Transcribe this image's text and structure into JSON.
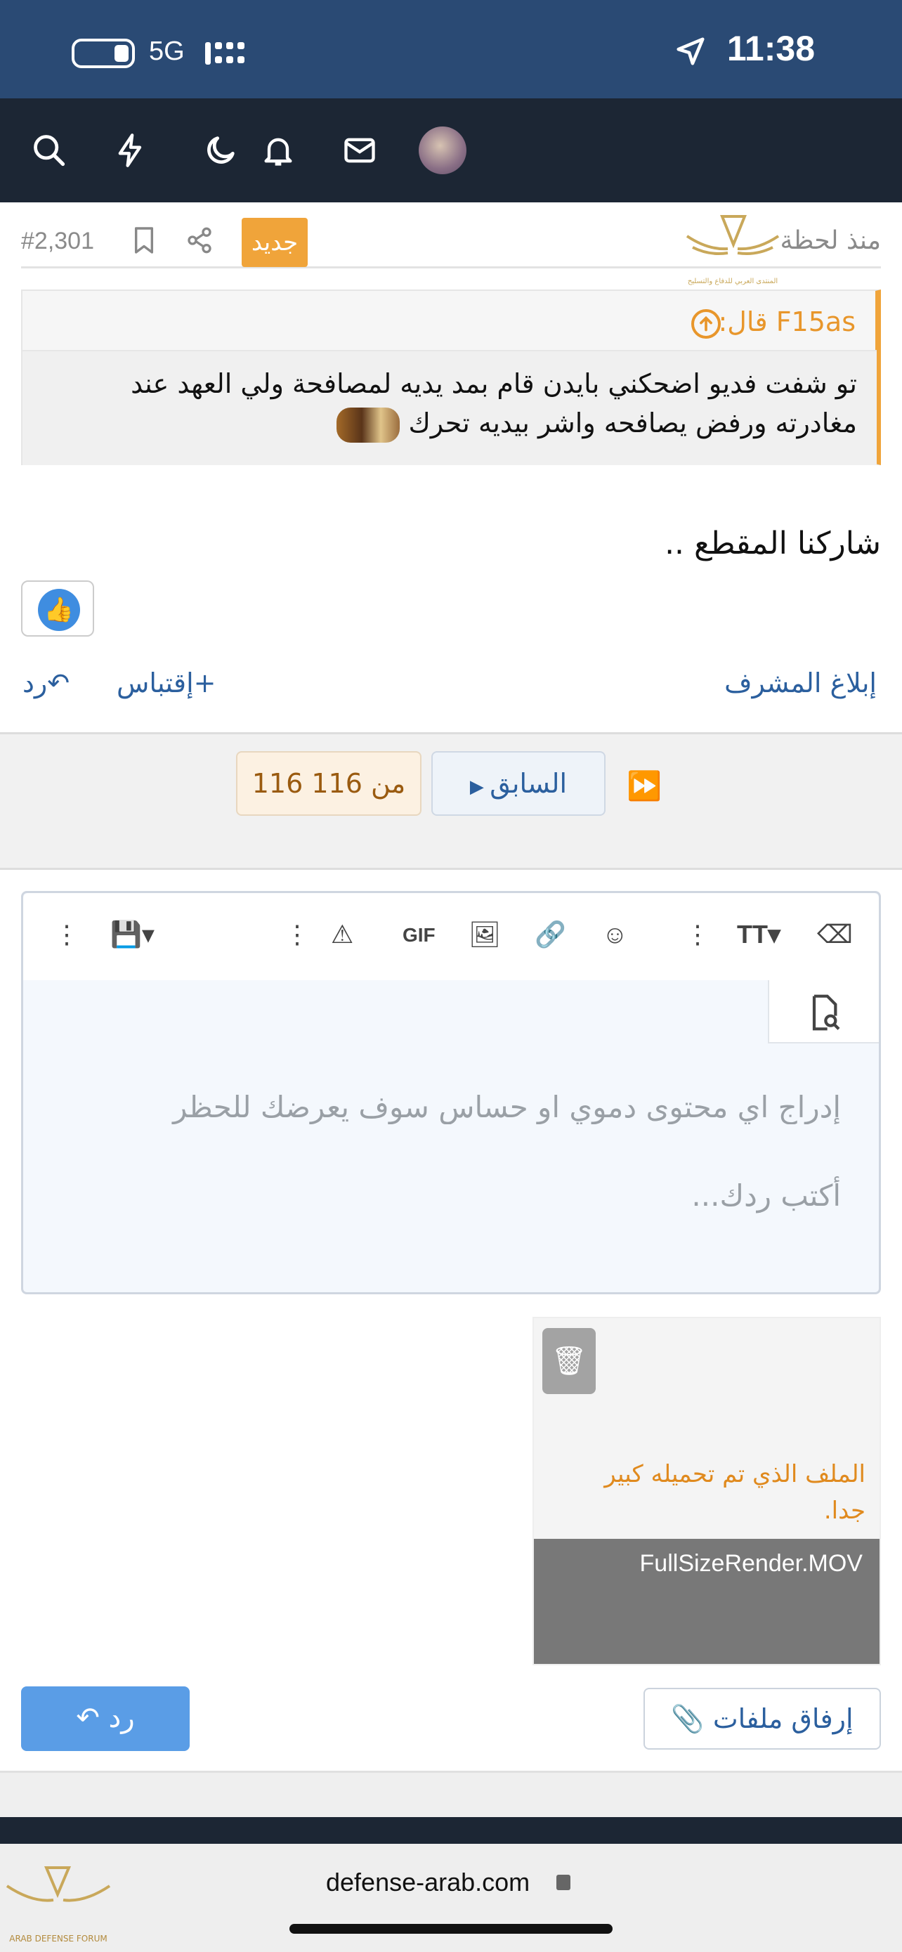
{
  "status": {
    "time": "11:38",
    "network": "5G"
  },
  "nav": {
    "logo_caption": "المنتدى العربي للدفاع والتسليح"
  },
  "post": {
    "time": "منذ لحظة",
    "number": "#2,301",
    "new_badge": "جديد"
  },
  "quote": {
    "author": "F15as قال:",
    "text": "تو شفت فديو اضحكني بايدن قام بمد يديه لمصافحة ولي العهد عند مغادرته ورفض يصافحه واشر بيديه تحرك"
  },
  "message": "شاركنا المقطع ..",
  "actions": {
    "report": "إبلاغ المشرف",
    "quote": "إقتباس",
    "reply": "رد"
  },
  "pager": {
    "count": "116 من 116",
    "prev": "السابق"
  },
  "editor": {
    "gif": "GIF",
    "placeholder1": "إدراج اي محتوى دموي او حساس سوف يعرضك للحظر",
    "placeholder2": "أكتب ردك..."
  },
  "attachment": {
    "error": "الملف الذي تم تحميله كبير جدا.",
    "filename": "FullSizeRender.MOV"
  },
  "buttons": {
    "attach": "إرفاق ملفات",
    "reply": "رد"
  },
  "browser": {
    "url": "defense-arab.com",
    "fav_caption": "ARAB DEFENSE FORUM"
  },
  "colors": {
    "nav": "#1c2634",
    "status": "#2a4a74",
    "accent": "#f0a43a",
    "link": "#2b5f9e",
    "button": "#5a9de6"
  }
}
